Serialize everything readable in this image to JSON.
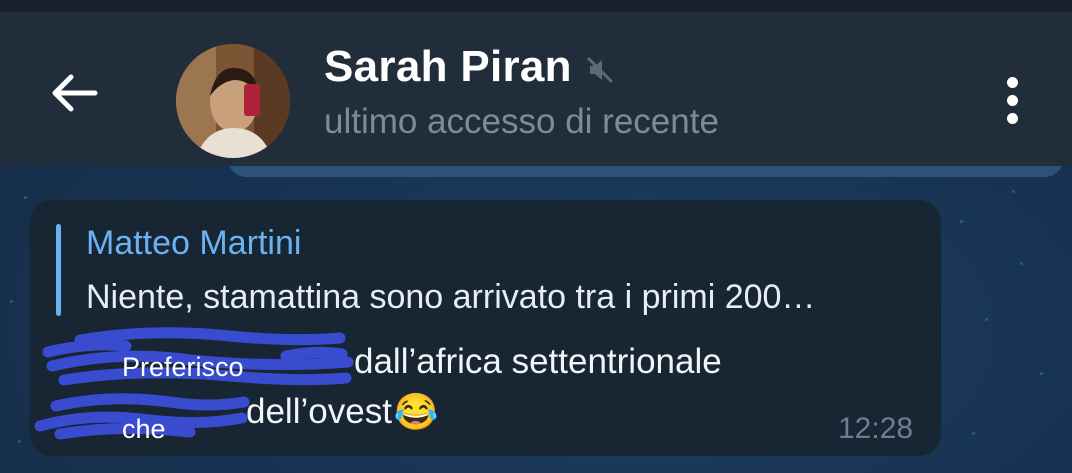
{
  "header": {
    "back_icon": "arrow-left-icon",
    "contact_name": "Sarah Piran",
    "muted_icon": "speaker-muted-icon",
    "status": "ultimo accesso di recente",
    "menu_icon": "more-vertical-icon"
  },
  "message": {
    "reply": {
      "author": "Matteo Martini",
      "snippet": "Niente, stamattina sono arrivato tra i primi 200…"
    },
    "line1_word": "Preferisco",
    "line1_text": "dall’africa settentrionale",
    "line2_word": "che",
    "line2_text": "dell’ovest",
    "emoji": "😂",
    "time": "12:28"
  },
  "colors": {
    "header_bg": "#212d3b",
    "bubble_bg": "#182533",
    "accent": "#6ab2f2",
    "redaction": "#3b4fd8"
  }
}
